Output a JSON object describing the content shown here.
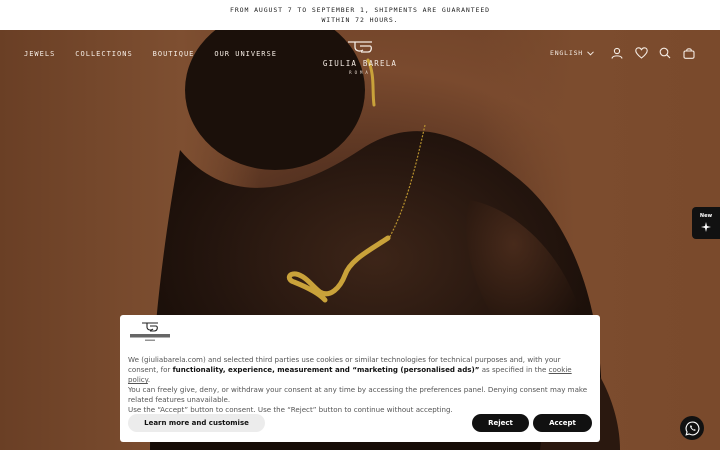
{
  "announcement": {
    "text": "FROM AUGUST 7 TO SEPTEMBER 1, SHIPMENTS ARE GUARANTEED WITHIN 72 HOURS."
  },
  "nav": {
    "items": [
      {
        "label": "JEWELS"
      },
      {
        "label": "COLLECTIONS"
      },
      {
        "label": "BOUTIQUE"
      },
      {
        "label": "OUR UNIVERSE"
      }
    ],
    "language": "ENGLISH",
    "icons": [
      "account-icon",
      "wishlist-icon",
      "search-icon",
      "bag-icon"
    ]
  },
  "brand": {
    "name": "GIULIA BARELA",
    "sub": "ROMA"
  },
  "badge": {
    "label": "New"
  },
  "cookie": {
    "text_1": "We (giuliabarela.com) and selected third parties use cookies or similar technologies for technical purposes and, with your consent, for ",
    "text_bold": "functionality, experience, measurement and “marketing (personalised ads)”",
    "text_2": " as specified in the ",
    "link": "cookie policy",
    "text_3": ".",
    "line_2": "You can freely give, deny, or withdraw your consent at any time by accessing the preferences panel. Denying consent may make related features unavailable.",
    "line_3": "Use the “Accept” button to consent. Use the “Reject” button to continue without accepting.",
    "learn_more_label": "Learn more and customise",
    "reject_label": "Reject",
    "accept_label": "Accept"
  },
  "colors": {
    "background": "#6e4228",
    "text_light": "#f5ece4",
    "button_dark": "#111111",
    "gold": "#c9a23a"
  }
}
